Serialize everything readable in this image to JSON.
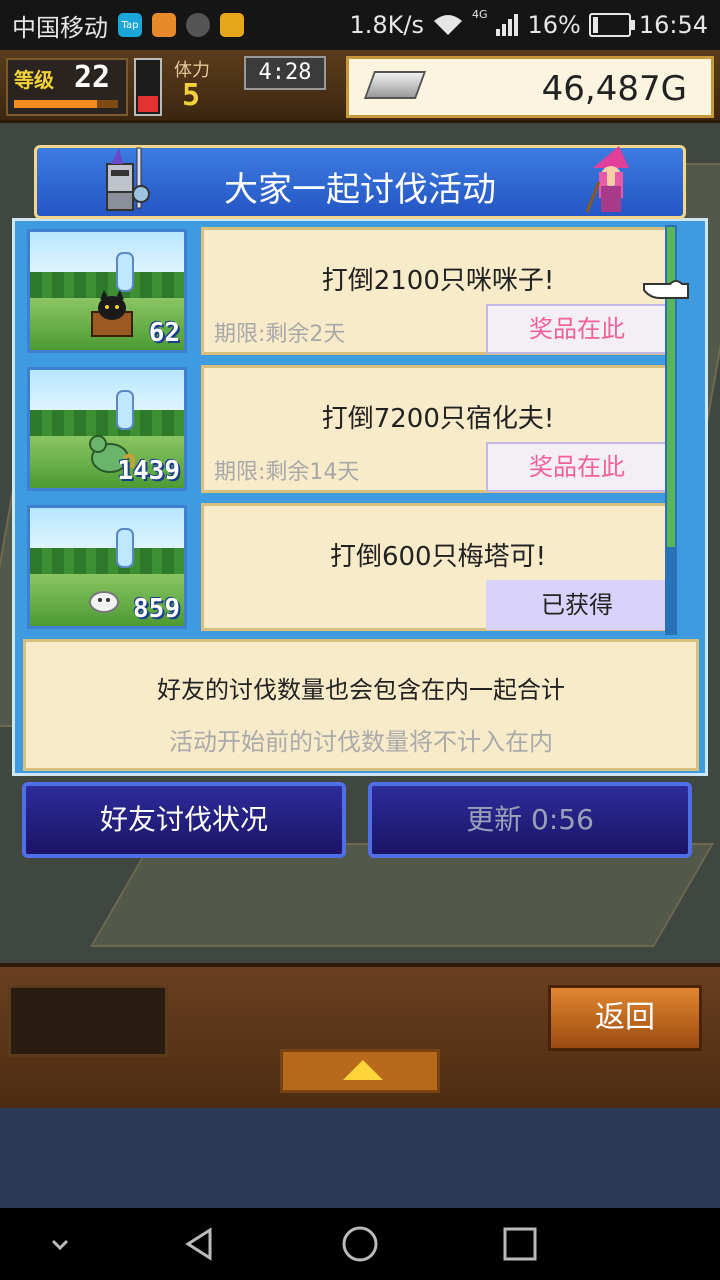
{
  "status_bar": {
    "carrier": "中国移动",
    "app_icons": [
      "Tap"
    ],
    "net_speed": "1.8K/s",
    "network": "4G",
    "battery": "16%",
    "battery_level": 0.16,
    "time": "16:54"
  },
  "hud": {
    "level_label": "等级",
    "level": "22",
    "stamina_label": "体力",
    "stamina": "5",
    "timer": "4:28",
    "gold": "46,487G"
  },
  "dialog": {
    "title": "大家一起讨伐活动",
    "quests": [
      {
        "count": "62",
        "text": "打倒2100只咪咪子!",
        "deadline": "期限:剩余2天",
        "button": "奖品在此",
        "status": "prize"
      },
      {
        "count": "1439",
        "text": "打倒7200只宿化夫!",
        "deadline": "期限:剩余14天",
        "button": "奖品在此",
        "status": "prize"
      },
      {
        "count": "859",
        "text": "打倒600只梅塔可!",
        "deadline": "",
        "button": "已获得",
        "status": "obtained"
      }
    ],
    "info_main": "好友的讨伐数量也会包含在内一起合计",
    "info_sub": "活动开始前的讨伐数量将不计入在内"
  },
  "buttons": {
    "friends_status": "好友讨伐状况",
    "refresh": "更新 0:56",
    "back": "返回"
  },
  "colors": {
    "dialog_blue": "#3f9be0",
    "card_bg": "#f8ebc9",
    "prize_pink": "#f0609a"
  }
}
